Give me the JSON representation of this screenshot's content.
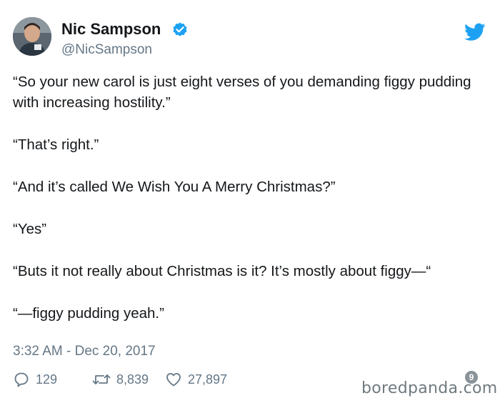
{
  "author": {
    "name": "Nic Sampson",
    "handle": "@NicSampson",
    "verified_color": "#1da1f2"
  },
  "tweet": {
    "paragraphs": [
      "“So your new carol is just eight verses of you demanding figgy pudding with increasing hostility.”",
      "“That’s right.”",
      "“And it’s called We Wish You A Merry Christmas?”",
      "“Yes”",
      "“Buts it not really about Christmas is it? It’s mostly about figgy—“",
      "“—figgy pudding yeah.”"
    ],
    "timestamp": "3:32 AM - Dec 20, 2017"
  },
  "actions": {
    "replies": "129",
    "retweets": "8,839",
    "likes": "27,897"
  },
  "watermark": {
    "text": "boredpanda.com",
    "badge": "9"
  },
  "colors": {
    "twitter_blue": "#1da1f2",
    "text": "#14171a",
    "muted": "#657786"
  }
}
